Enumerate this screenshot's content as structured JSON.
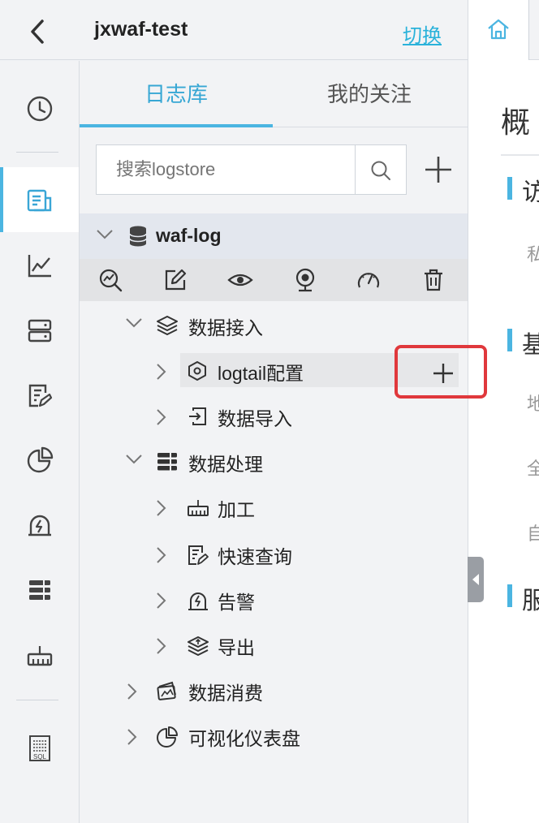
{
  "header": {
    "project_name": "jxwaf-test",
    "switch_label": "切换"
  },
  "tabs": [
    {
      "label": "日志库",
      "active": true
    },
    {
      "label": "我的关注",
      "active": false
    }
  ],
  "search": {
    "placeholder": "搜索logstore"
  },
  "project": {
    "name": "waf-log"
  },
  "tree": {
    "data_ingest": {
      "label": "数据接入",
      "children": [
        "logtail配置",
        "数据导入"
      ]
    },
    "data_process": {
      "label": "数据处理",
      "children": [
        "加工",
        "快速查询",
        "告警",
        "导出"
      ]
    },
    "data_consume": {
      "label": "数据消费"
    },
    "dashboard": {
      "label": "可视化仪表盘"
    }
  },
  "right_pane": {
    "title_partial": "概",
    "sections": [
      "访",
      "基",
      "服"
    ],
    "fields": [
      "私",
      "地",
      "全",
      "自"
    ]
  },
  "colors": {
    "accent": "#4bb5e1",
    "highlight_box": "#e0383c"
  }
}
